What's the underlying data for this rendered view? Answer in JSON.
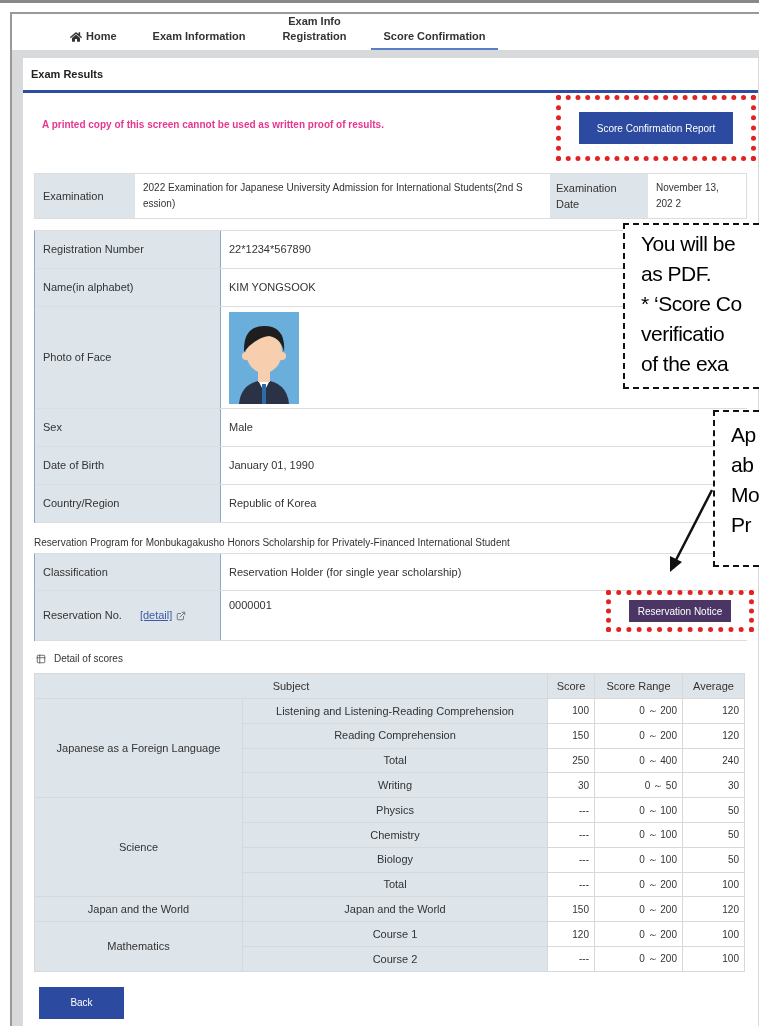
{
  "tabs": [
    {
      "label": "Home",
      "kind": "home",
      "selected": false
    },
    {
      "label": "Exam Information",
      "kind": "text",
      "selected": false
    },
    {
      "label": "Exam Info Registration",
      "kind": "text",
      "selected": false
    },
    {
      "label": "Score Confirmation",
      "kind": "text",
      "selected": true
    }
  ],
  "panel_title": "Exam Results",
  "notice": "A printed copy of this screen cannot be used as written proof of results.",
  "report_button": "Score Confirmation Report",
  "exam": {
    "label": "Examination",
    "value": "2022 Examination for Japanese University Admission for International Students(2nd S ession)",
    "date_label": "Examination Date",
    "date": "November 13, 202 2"
  },
  "profile": [
    {
      "label": "Registration Number",
      "value": "22*1234*567890",
      "kind": "text"
    },
    {
      "label": "Name(in alphabet)",
      "value": "KIM YONGSOOK",
      "kind": "text"
    },
    {
      "label": "Photo of Face"
    },
    {
      "label": "Sex",
      "value": "Male",
      "kind": "text"
    },
    {
      "label": "Date of Birth",
      "value": "January 01, 1990",
      "kind": "text"
    },
    {
      "label": "Country/Region",
      "value": "Republic of Korea",
      "kind": "text"
    }
  ],
  "scholarship": {
    "caption": "Reservation Program for Monbukagakusho Honors Scholarship for Privately-Financed International Student",
    "classification_label": "Classification",
    "classification": "Reservation Holder (for single year scholarship)",
    "number_label": "Reservation No.",
    "detail_link": "[detail]",
    "number": "0000001",
    "notice_button": "Reservation Notice"
  },
  "scores": {
    "title": "Detail of scores",
    "columns": [
      "Subject",
      "Score",
      "Score Range",
      "Average"
    ],
    "groups": [
      {
        "subject": "Japanese as a Foreign Language",
        "items": [
          {
            "name": "Listening and Listening-Reading Comprehension",
            "score": "100",
            "range": "0 ～ 200",
            "average": "120"
          },
          {
            "name": "Reading Comprehension",
            "score": "150",
            "range": "0 ～ 200",
            "average": "120"
          },
          {
            "name": "Total",
            "score": "250",
            "range": "0 ～ 400",
            "average": "240"
          },
          {
            "name": "Writing",
            "score": "30",
            "range": "0 ～ 50",
            "average": "30"
          }
        ]
      },
      {
        "subject": "Science",
        "items": [
          {
            "name": "Physics",
            "score": "---",
            "range": "0 ～ 100",
            "average": "50"
          },
          {
            "name": "Chemistry",
            "score": "---",
            "range": "0 ～ 100",
            "average": "50"
          },
          {
            "name": "Biology",
            "score": "---",
            "range": "0 ～ 100",
            "average": "50"
          },
          {
            "name": "Total",
            "score": "---",
            "range": "0 ～ 200",
            "average": "100"
          }
        ]
      },
      {
        "subject": "Japan and the World",
        "items": [
          {
            "name": "Japan and the World",
            "score": "150",
            "range": "0 ～ 200",
            "average": "120"
          }
        ]
      },
      {
        "subject": "Mathematics",
        "items": [
          {
            "name": "Course 1",
            "score": "120",
            "range": "0 ～ 200",
            "average": "100"
          },
          {
            "name": "Course 2",
            "score": "---",
            "range": "0 ～ 200",
            "average": "100"
          }
        ]
      }
    ]
  },
  "back_button": "Back",
  "callouts": [
    {
      "lines": [
        "You will be",
        "as PDF.",
        "* ‘Score Co",
        "verificatio",
        "of the exa"
      ]
    },
    {
      "lines": [
        "Ap",
        "ab",
        "Mo",
        "Pr"
      ]
    }
  ]
}
